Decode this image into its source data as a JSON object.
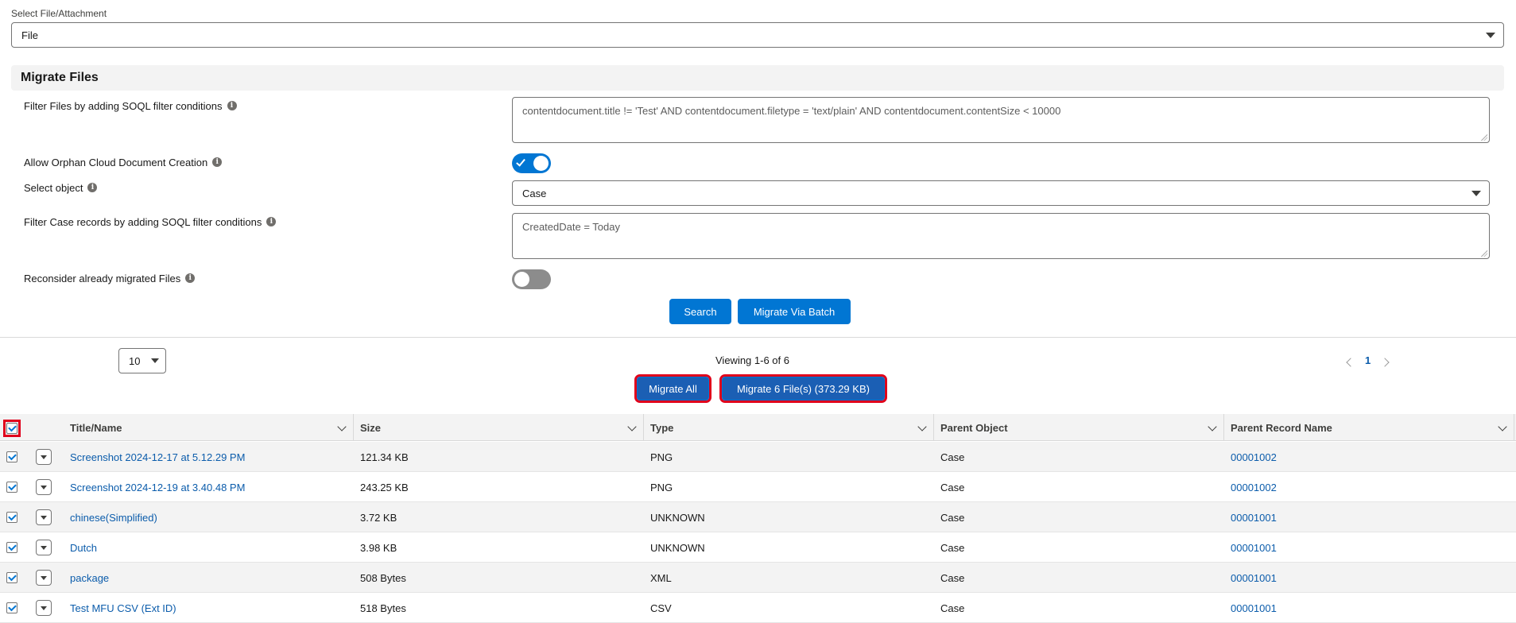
{
  "file_attachment": {
    "label": "Select File/Attachment",
    "value": "File"
  },
  "section": {
    "title": "Migrate Files"
  },
  "form": {
    "filter_files_label": "Filter Files by adding SOQL filter conditions",
    "filter_files_value": "contentdocument.title != 'Test' AND contentdocument.filetype = 'text/plain' AND contentdocument.contentSize < 10000",
    "orphan_label": "Allow Orphan Cloud Document Creation",
    "orphan_enabled": true,
    "select_object_label": "Select object",
    "select_object_value": "Case",
    "filter_records_label": "Filter Case records by adding SOQL filter conditions",
    "filter_records_value": "CreatedDate = Today",
    "reconsider_label": "Reconsider already migrated Files",
    "reconsider_enabled": false,
    "info_glyph": "i"
  },
  "buttons": {
    "search": "Search",
    "migrate_batch": "Migrate Via Batch",
    "migrate_all": "Migrate All",
    "migrate_selected": "Migrate 6 File(s) (373.29 KB)"
  },
  "pagination": {
    "page_size": "10",
    "viewing": "Viewing 1-6 of 6",
    "current_page": "1"
  },
  "table": {
    "columns": [
      "Title/Name",
      "Size",
      "Type",
      "Parent Object",
      "Parent Record Name"
    ],
    "rows": [
      {
        "title": "Screenshot 2024-12-17 at 5.12.29 PM",
        "size": "121.34 KB",
        "type": "PNG",
        "parent_object": "Case",
        "parent_record": "00001002"
      },
      {
        "title": "Screenshot 2024-12-19 at 3.40.48 PM",
        "size": "243.25 KB",
        "type": "PNG",
        "parent_object": "Case",
        "parent_record": "00001002"
      },
      {
        "title": "chinese(Simplified)",
        "size": "3.72 KB",
        "type": "UNKNOWN",
        "parent_object": "Case",
        "parent_record": "00001001"
      },
      {
        "title": "Dutch",
        "size": "3.98 KB",
        "type": "UNKNOWN",
        "parent_object": "Case",
        "parent_record": "00001001"
      },
      {
        "title": "package",
        "size": "508 Bytes",
        "type": "XML",
        "parent_object": "Case",
        "parent_record": "00001001"
      },
      {
        "title": "Test MFU CSV (Ext ID)",
        "size": "518 Bytes",
        "type": "CSV",
        "parent_object": "Case",
        "parent_record": "00001001"
      }
    ]
  },
  "colors": {
    "brand": "#0176d3",
    "highlight_border": "#e0001b",
    "link": "#0b5cab"
  }
}
